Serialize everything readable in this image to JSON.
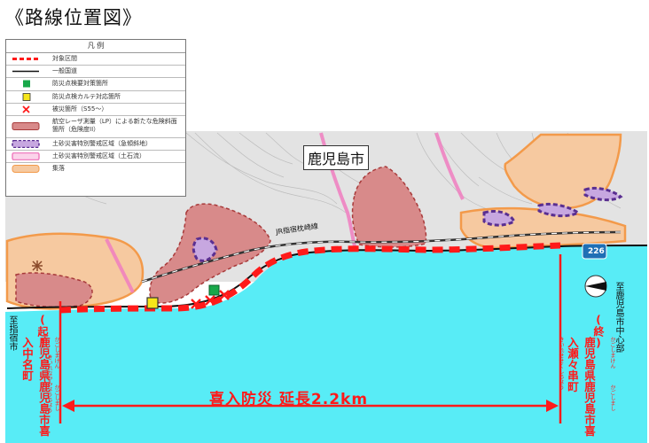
{
  "title": "《路線位置図》",
  "legend": {
    "header": "凡  例",
    "items": [
      {
        "label": "対象区間",
        "symbol": "red-dashed-line"
      },
      {
        "label": "一般国道",
        "symbol": "black-line"
      },
      {
        "label": "防災点検要対策箇所",
        "symbol": "green-square"
      },
      {
        "label": "防災点検カルテ対応箇所",
        "symbol": "yellow-square"
      },
      {
        "label": "被災箇所（S55～）",
        "symbol": "red-x"
      },
      {
        "label": "航空レーザ測量（LP）による新たな危険斜面箇所（危険度II）",
        "symbol": "red-hatched-area"
      },
      {
        "label": "土砂災害特別警戒区域（急傾斜地）",
        "symbol": "purple-area"
      },
      {
        "label": "土砂災害特別警戒区域（土石流）",
        "symbol": "pink-area"
      },
      {
        "label": "集落",
        "symbol": "orange-area"
      }
    ]
  },
  "labels": {
    "city": "鹿児島市",
    "jr_line": "JR指宿枕崎線",
    "route_number": "226",
    "distance": "喜入防災  延長2.2km",
    "left_direction": "至指宿市",
    "right_direction": "至鹿児島市中心部",
    "start_marker": "(起)",
    "start_place": "鹿児島県鹿児島市喜入中名町",
    "start_furigana_1": "かごしまけん",
    "start_furigana_2": "かごしまし",
    "start_furigana_3": "きいれなかみょうちょう",
    "end_marker": "(終)",
    "end_place": "鹿児島県鹿児島市喜入瀬々串町",
    "end_furigana_1": "かごしまけん",
    "end_furigana_2": "かごしまし",
    "end_furigana_3": "きいれせせくしちょう"
  },
  "colors": {
    "sea": "#58ecf6",
    "land": "#e3e3e3",
    "route": "#ff1a1a",
    "hazard": "#c45a5a",
    "purple": "#7a4fa8",
    "pink": "#f07ec0",
    "settlement": "#f39a4a",
    "highway_badge": "#1f6fb5"
  },
  "icons": {
    "north_arrow": "north-arrow-icon",
    "damage_marker": "x-icon",
    "check_green": "green-square-icon",
    "check_yellow": "yellow-square-icon",
    "route_shield": "route-shield-icon"
  }
}
